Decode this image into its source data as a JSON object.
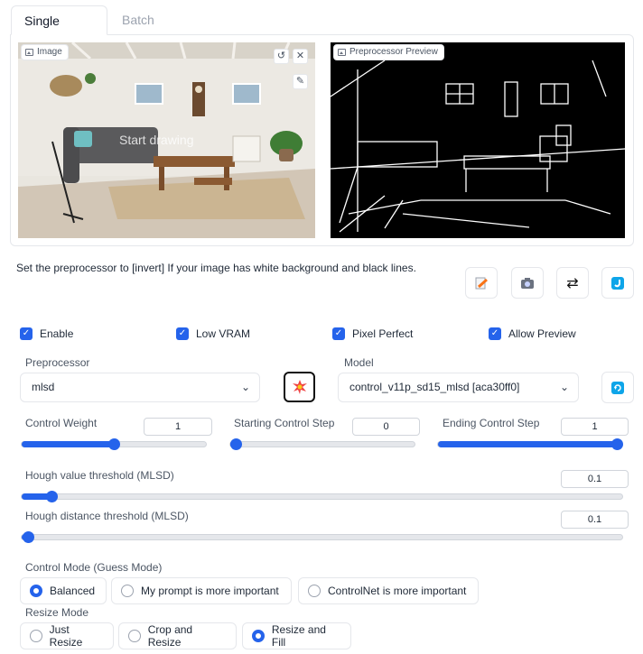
{
  "tabs": [
    {
      "label": "Single Image",
      "active": true
    },
    {
      "label": "Batch",
      "active": false
    }
  ],
  "image_panel": {
    "label": "Image",
    "overlay_text": "Start drawing"
  },
  "preview_panel": {
    "label": "Preprocessor Preview"
  },
  "info_text": "Set the preprocessor to [invert] If your image has white background and black lines.",
  "toolbar_icons": [
    "edit-image-icon",
    "camera-icon",
    "swap-icon",
    "send-dimensions-icon"
  ],
  "checkboxes": {
    "enable": {
      "label": "Enable",
      "checked": true
    },
    "low_vram": {
      "label": "Low VRAM",
      "checked": true
    },
    "pixel_perfect": {
      "label": "Pixel Perfect",
      "checked": true
    },
    "allow_preview": {
      "label": "Allow Preview",
      "checked": true
    }
  },
  "preprocessor": {
    "label": "Preprocessor",
    "value": "mlsd"
  },
  "model": {
    "label": "Model",
    "value": "control_v11p_sd15_mlsd [aca30ff0]"
  },
  "sliders": {
    "control_weight": {
      "label": "Control Weight",
      "value": "1",
      "fraction": 0.5
    },
    "starting_step": {
      "label": "Starting Control Step",
      "value": "0",
      "fraction": 0.0
    },
    "ending_step": {
      "label": "Ending Control Step",
      "value": "1",
      "fraction": 1.0
    },
    "hough_value": {
      "label": "Hough value threshold (MLSD)",
      "value": "0.1",
      "fraction": 0.05
    },
    "hough_distance": {
      "label": "Hough distance threshold (MLSD)",
      "value": "0.1",
      "fraction": 0.01
    }
  },
  "control_mode": {
    "label": "Control Mode (Guess Mode)",
    "options": [
      "Balanced",
      "My prompt is more important",
      "ControlNet is more important"
    ],
    "selected": "Balanced"
  },
  "resize_mode": {
    "label": "Resize Mode",
    "options": [
      "Just Resize",
      "Crop and Resize",
      "Resize and Fill"
    ],
    "selected": "Resize and Fill"
  },
  "colors": {
    "accent": "#2563eb",
    "border": "#e5e7eb"
  }
}
